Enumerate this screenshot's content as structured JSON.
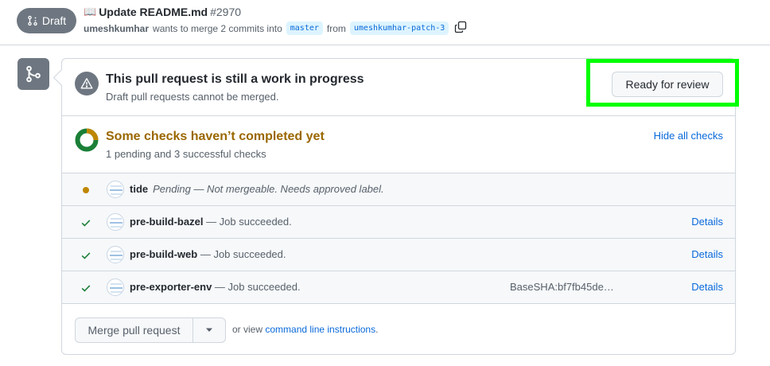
{
  "header": {
    "badge_label": "Draft",
    "book_emoji": "📖",
    "title": "Update README.md",
    "number": "#2970",
    "author": "umeshkumhar",
    "merge_text": "wants to merge 2 commits into",
    "base_branch": "master",
    "from_text": "from",
    "head_branch": "umeshkumhar-patch-3"
  },
  "wip": {
    "title": "This pull request is still a work in progress",
    "subtitle": "Draft pull requests cannot be merged.",
    "ready_button": "Ready for review"
  },
  "checks_summary": {
    "title": "Some checks haven’t completed yet",
    "subtitle": "1 pending and 3 successful checks",
    "hide_link": "Hide all checks",
    "pending_count": 1,
    "success_count": 3
  },
  "checks": [
    {
      "name": "tide",
      "status": "pending",
      "description": "Pending — Not mergeable. Needs approved label.",
      "extra": "",
      "details": ""
    },
    {
      "name": "pre-build-bazel",
      "status": "success",
      "description": " — Job succeeded.",
      "extra": "",
      "details": "Details"
    },
    {
      "name": "pre-build-web",
      "status": "success",
      "description": " — Job succeeded.",
      "extra": "",
      "details": "Details"
    },
    {
      "name": "pre-exporter-env",
      "status": "success",
      "description": " — Job succeeded.",
      "extra": "BaseSHA:bf7fb45de…",
      "details": "Details"
    }
  ],
  "merge": {
    "button": "Merge pull request",
    "or_view": "or view",
    "cli_link": "command line instructions",
    "period": "."
  },
  "colors": {
    "accent_link": "#0969da",
    "pending": "#bf8700",
    "success": "#1a7f37",
    "warning_title": "#9a6700",
    "highlight": "#00ff00"
  }
}
